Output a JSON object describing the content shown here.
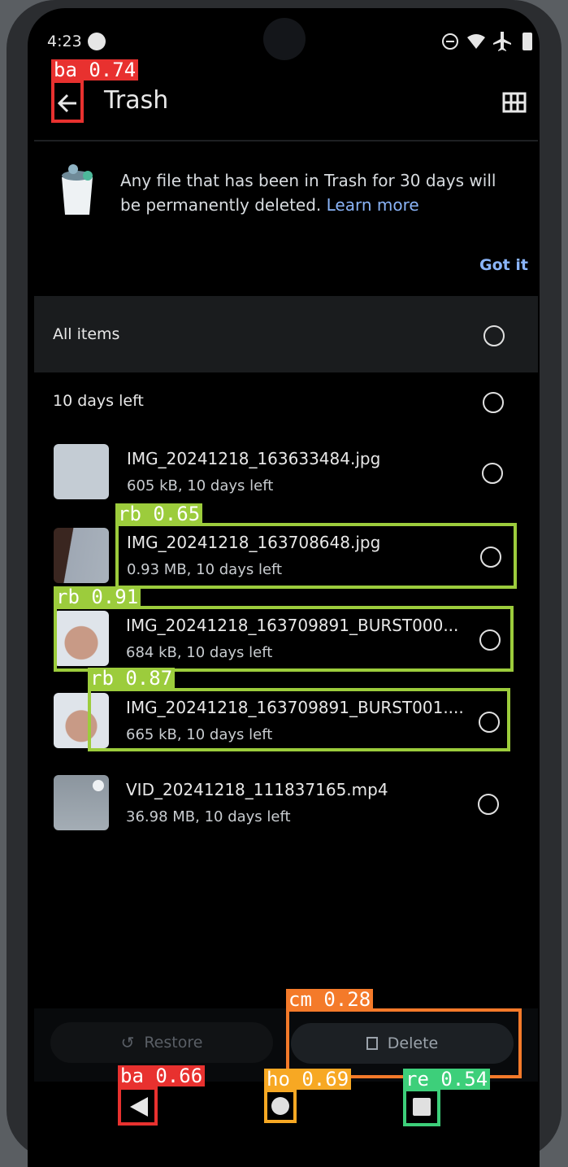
{
  "status_bar": {
    "time": "4:23",
    "icons": [
      "app-notification-icon",
      "do-not-disturb-icon",
      "wifi-icon",
      "airplane-mode-icon",
      "battery-icon"
    ]
  },
  "header": {
    "title": "Trash",
    "back_icon": "arrow-left-icon",
    "view_icon": "grid-view-icon"
  },
  "banner": {
    "text": "Any file that has been in Trash for 30 days will be permanently deleted.",
    "link": "Learn more",
    "dismiss": "Got it"
  },
  "all_items": {
    "label": "All items"
  },
  "group": {
    "label": "10 days left"
  },
  "files": [
    {
      "name": "IMG_20241218_163633484.jpg",
      "meta": "605 kB, 10 days left"
    },
    {
      "name": "IMG_20241218_163708648.jpg",
      "meta": "0.93 MB, 10 days left"
    },
    {
      "name": "IMG_20241218_163709891_BURST000...",
      "meta": "684 kB, 10 days left"
    },
    {
      "name": "IMG_20241218_163709891_BURST001....",
      "meta": "665 kB, 10 days left"
    },
    {
      "name": "VID_20241218_111837165.mp4",
      "meta": "36.98 MB, 10 days left"
    }
  ],
  "actions": {
    "restore": "Restore",
    "delete": "Delete"
  },
  "nav": {
    "back": "back-triangle-icon",
    "home": "home-circle-icon",
    "recents": "recents-square-icon"
  },
  "detections": [
    {
      "label": "ba 0.74",
      "color": "#e8312f"
    },
    {
      "label": "rb 0.65",
      "color": "#9ccc3c"
    },
    {
      "label": "rb 0.91",
      "color": "#9ccc3c"
    },
    {
      "label": "rb 0.87",
      "color": "#9ccc3c"
    },
    {
      "label": "cm 0.28",
      "color": "#f47a2a"
    },
    {
      "label": "ba 0.66",
      "color": "#e8312f"
    },
    {
      "label": "ho 0.69",
      "color": "#f7a823"
    },
    {
      "label": "re 0.54",
      "color": "#3dcf7a"
    }
  ]
}
